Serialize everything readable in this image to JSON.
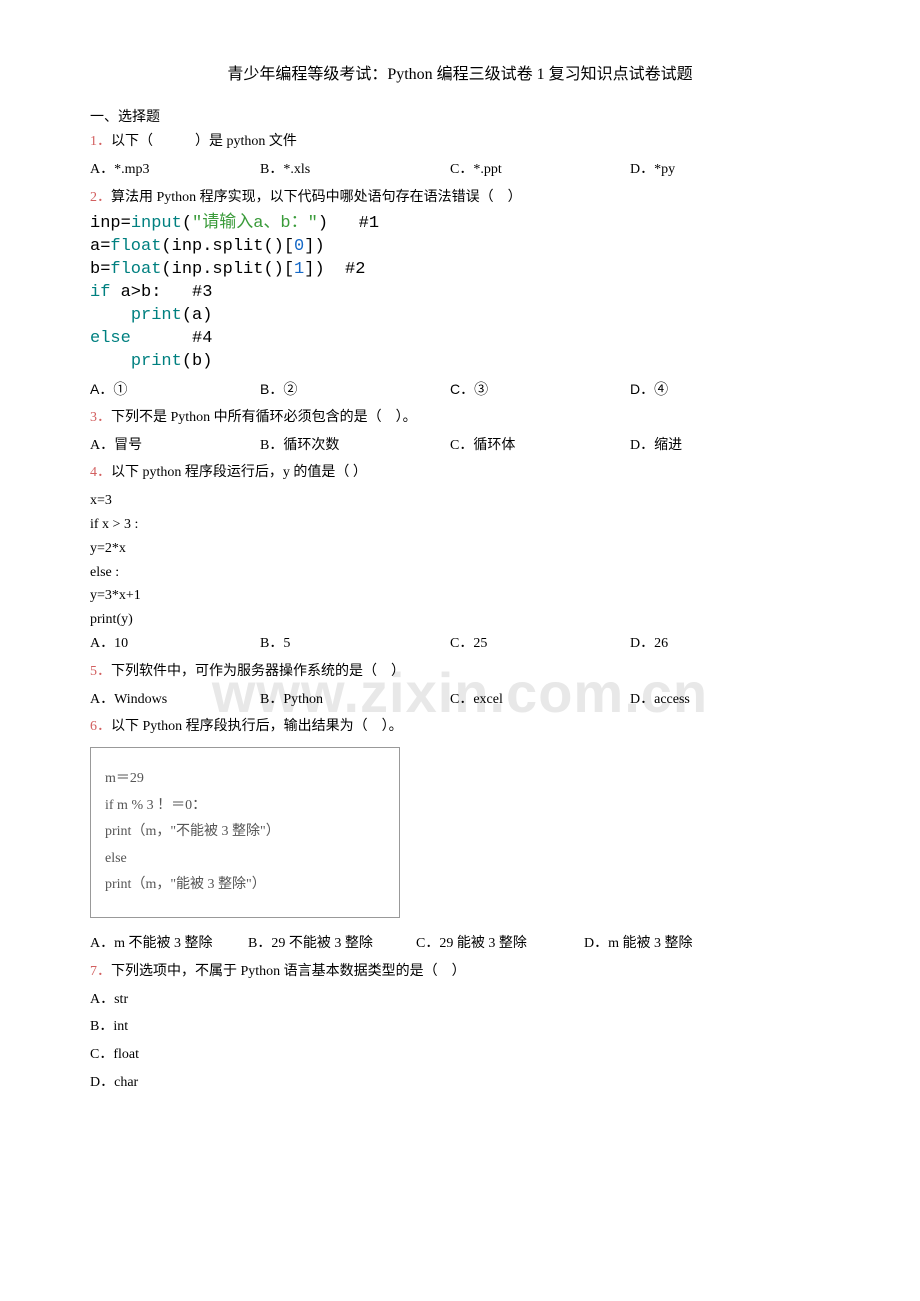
{
  "title": "青少年编程等级考试：Python 编程三级试卷 1 复习知识点试卷试题",
  "section1": "一、选择题",
  "watermark": "www.zixin.com.cn",
  "q1": {
    "num": "1．",
    "text": "以下（　　　）是 python 文件",
    "optA": "A．*.mp3",
    "optB": "B．*.xls",
    "optC": "C．*.ppt",
    "optD": "D．*py"
  },
  "q2": {
    "num": "2．",
    "text": "算法用 Python 程序实现，以下代码中哪处语句存在语法错误（　）",
    "code": {
      "l1a": "inp=",
      "l1b": "input",
      "l1c": "(",
      "l1d": "\"请输入a、b：\"",
      "l1e": ")",
      "l1f": "   #1",
      "l2a": "a=",
      "l2b": "float",
      "l2c": "(inp.split()[",
      "l2d": "0",
      "l2e": "])",
      "l3a": "b=",
      "l3b": "float",
      "l3c": "(inp.split()[",
      "l3d": "1",
      "l3e": "])",
      "l3f": "  #2",
      "l4a": "if ",
      "l4b": "a>b:",
      "l4c": "   #3",
      "l5a": "    ",
      "l5b": "print",
      "l5c": "(a)",
      "l6a": "else",
      "l6b": "      #4",
      "l7a": "    ",
      "l7b": "print",
      "l7c": "(b)"
    },
    "optA": "A．①",
    "optB": "B．②",
    "optC": "C．③",
    "optD": "D．④"
  },
  "q3": {
    "num": "3．",
    "text": "下列不是 Python 中所有循环必须包含的是（　）。",
    "optA": "A．冒号",
    "optB": "B．循环次数",
    "optC": "C．循环体",
    "optD": "D．缩进"
  },
  "q4": {
    "num": "4．",
    "text": "以下 python 程序段运行后，y 的值是（ ）",
    "code": {
      "l1": "x=3",
      "l2": "if x > 3 :",
      "l3": "  y=2*x",
      "l4": "else :",
      "l5": "  y=3*x+1",
      "l6": "print(y)"
    },
    "optA": "A．10",
    "optB": "B．5",
    "optC": "C．25",
    "optD": "D．26"
  },
  "q5": {
    "num": "5．",
    "text": "下列软件中，可作为服务器操作系统的是（　）",
    "optA": "A．Windows",
    "optB": "B．Python",
    "optC": "C．excel",
    "optD": "D．access"
  },
  "q6": {
    "num": "6．",
    "text": "以下 Python 程序段执行后，输出结果为（　）。",
    "code": {
      "l1": "m＝29",
      "l2": "if  m  %  3  ！＝0：",
      "l3": "   print（m，\"不能被 3 整除\"）",
      "l4": "else",
      "l5": "   print（m，\"能被 3 整除\"）"
    },
    "optA": "A．m 不能被 3 整除",
    "optB": "B．29 不能被 3 整除",
    "optC": "C．29 能被 3 整除",
    "optD": "D．m 能被 3 整除"
  },
  "q7": {
    "num": "7．",
    "text": "下列选项中，不属于 Python 语言基本数据类型的是（　）",
    "optA": "A．str",
    "optB": "B．int",
    "optC": "C．float",
    "optD": "D．char"
  }
}
